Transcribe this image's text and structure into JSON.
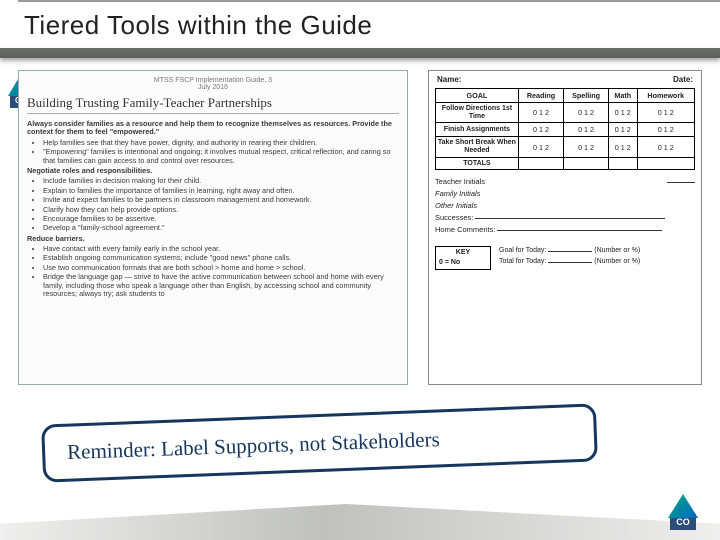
{
  "title": "Tiered Tools within the Guide",
  "doc": {
    "header1": "MTSS FSCP Implementation Guide, 3",
    "header2": "July 2016",
    "title": "Building Trusting Family-Teacher Partnerships",
    "lead": "Always consider families as a resource and help them to recognize themselves as resources. Provide the context for them to feel \"empowered.\"",
    "lead_b1": "Help families see that they have power, dignity, and authority in rearing their children.",
    "lead_b2": "\"Empowering\" families is intentional and ongoing; it involves mutual respect, critical reflection, and caring so that families can gain access to and control over resources.",
    "sec2": "Negotiate roles and responsibilities.",
    "s2b1": "Include families in decision making for their child.",
    "s2b2": "Explain to families the importance of families in learning, right away and often.",
    "s2b3": "Invite and expect families to be partners in classroom management and homework.",
    "s2b4": "Clarify how they can help provide options.",
    "s2b5": "Encourage families to be assertive.",
    "s2b6": "Develop a \"family-school agreement.\"",
    "sec3": "Reduce barriers.",
    "s3b1": "Have contact with every family early in the school year.",
    "s3b2": "Establish ongoing communication systems; include \"good news\" phone calls.",
    "s3b3": "Use two communication formats that are both school > home and home > school.",
    "s3b4": "Bridge the language gap — strive to have the active communication between school and home with every family, including those who speak a language other than English, by accessing school and community resources; always try; ask students to"
  },
  "form": {
    "name_label": "Name:",
    "date_label": "Date:",
    "hdr_goal": "GOAL",
    "hdr_reading": "Reading",
    "hdr_spelling": "Spelling",
    "hdr_math": "Math",
    "hdr_homework": "Homework",
    "row1": "Follow Directions 1st Time",
    "row2": "Finish Assignments",
    "row3": "Take Short Break When Needed",
    "row4": "TOTALS",
    "cell": "0 1 2",
    "teacher_initials": "Teacher Initials",
    "family_initials": "Family Initials",
    "other_initials": "Other Initials",
    "successes": "Successes:",
    "home_comments": "Home Comments:",
    "key_title": "KEY",
    "key_0": "0 = No",
    "goal_today": "Goal for Today:",
    "total_today": "Total for Today:",
    "number_pct": "(Number or %)"
  },
  "bubble": "Reminder: Label Supports, not Stakeholders",
  "logo_text": "CO"
}
